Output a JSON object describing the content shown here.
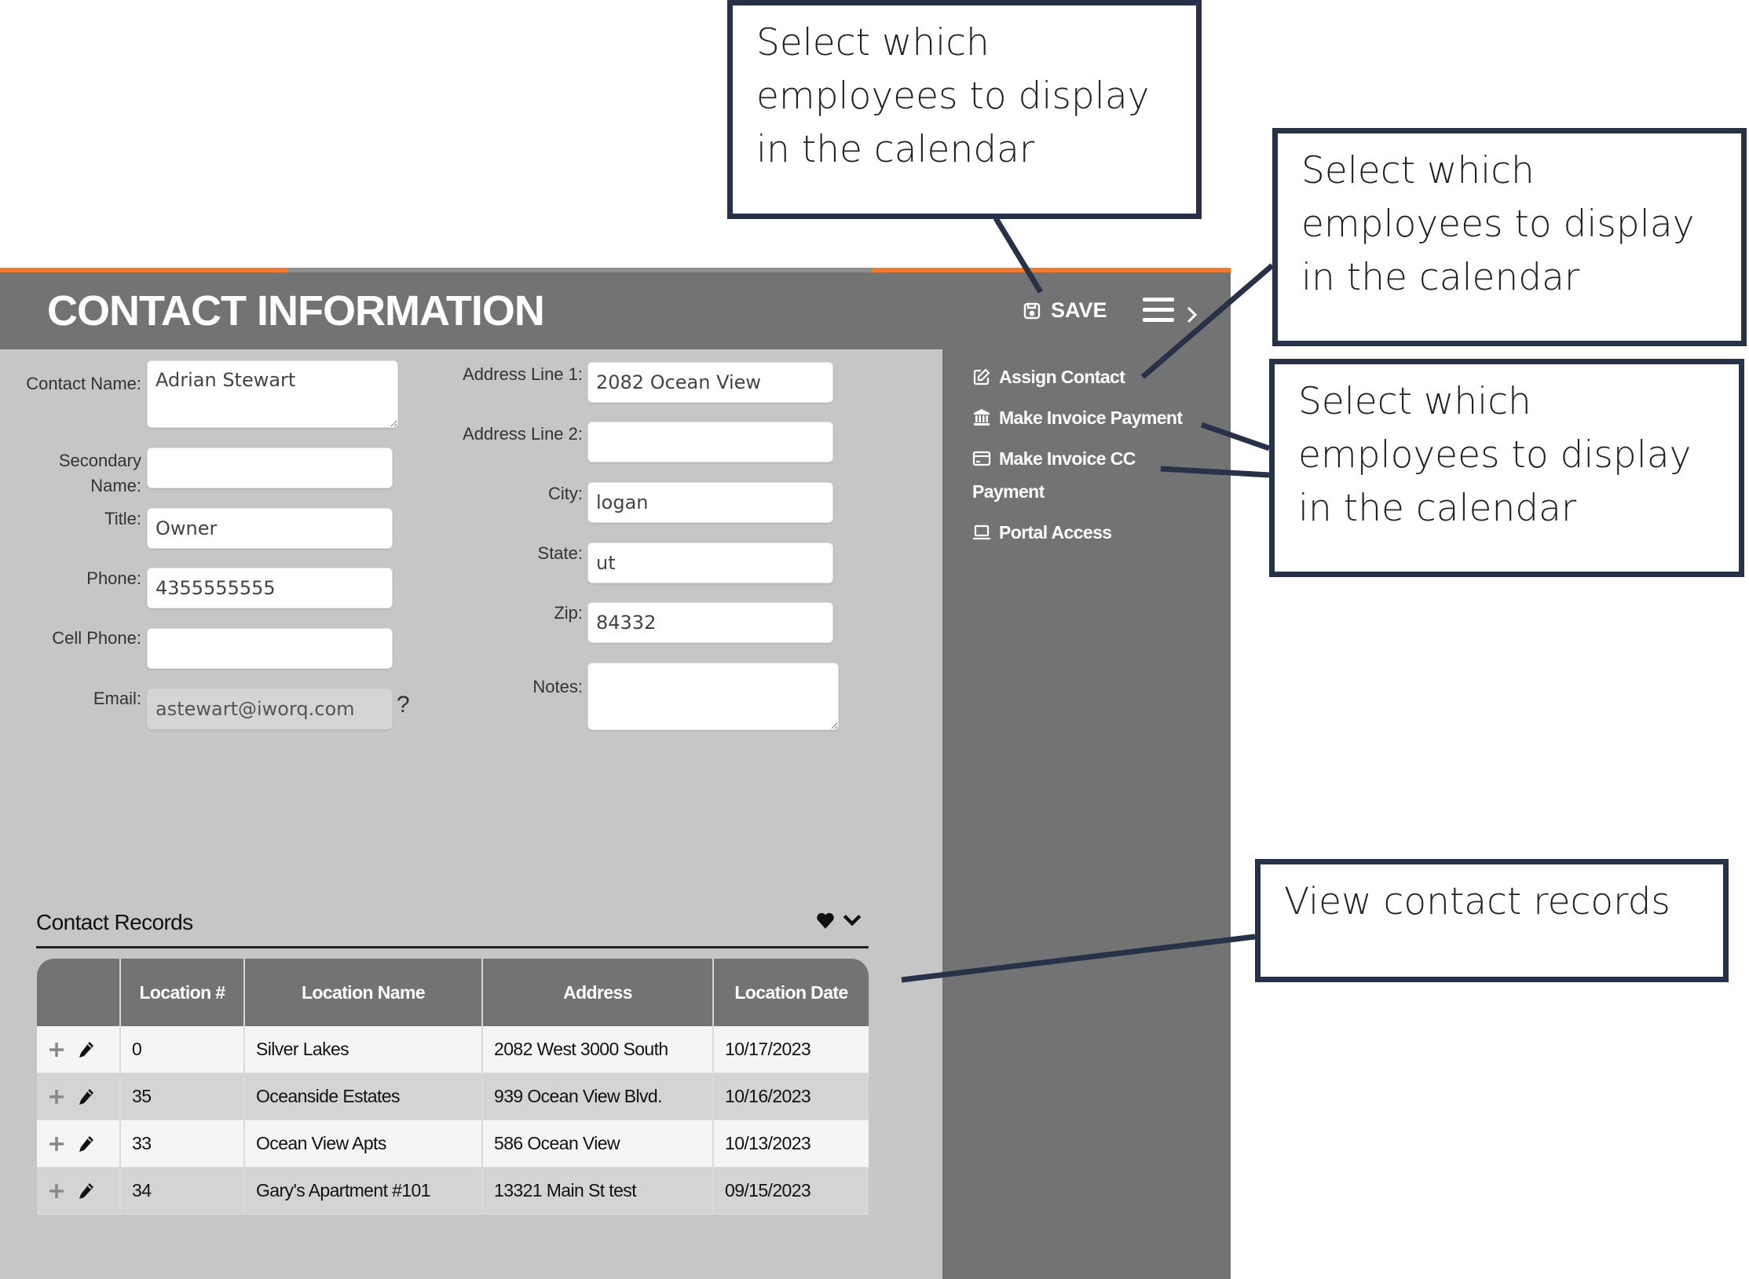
{
  "header": {
    "title": "CONTACT INFORMATION",
    "save_label": "SAVE",
    "save_icon": "floppy-disk-icon",
    "menu_icon": "hamburger-menu-icon",
    "expand_icon": "chevron-right-icon"
  },
  "sidebar": {
    "items": [
      {
        "label": "Assign Contact",
        "icon": "edit-icon"
      },
      {
        "label": "Make Invoice Payment",
        "icon": "bank-icon"
      },
      {
        "label": "Make Invoice CC Payment",
        "icon": "credit-card-icon"
      },
      {
        "label": "Portal Access",
        "icon": "laptop-icon"
      }
    ]
  },
  "form": {
    "left": {
      "contact_name": {
        "label": "Contact Name:",
        "value": "Adrian Stewart"
      },
      "secondary_name": {
        "label": "Secondary Name:",
        "value": ""
      },
      "title": {
        "label": "Title:",
        "value": "Owner"
      },
      "phone": {
        "label": "Phone:",
        "value": "4355555555"
      },
      "cell_phone": {
        "label": "Cell Phone:",
        "value": ""
      },
      "email": {
        "label": "Email:",
        "value": "astewart@iworq.com",
        "help": "?"
      }
    },
    "right": {
      "address1": {
        "label": "Address Line 1:",
        "value": "2082 Ocean View"
      },
      "address2": {
        "label": "Address Line 2:",
        "value": ""
      },
      "city": {
        "label": "City:",
        "value": "logan"
      },
      "state": {
        "label": "State:",
        "value": "ut"
      },
      "zip": {
        "label": "Zip:",
        "value": "84332"
      },
      "notes": {
        "label": "Notes:",
        "value": ""
      }
    }
  },
  "records": {
    "title": "Contact Records",
    "favorite_icon": "heart-icon",
    "collapse_icon": "chevron-down-icon",
    "columns": [
      "",
      "Location #",
      "Location Name",
      "Address",
      "Location Date"
    ],
    "rows": [
      {
        "location_num": "0",
        "location_name": "Silver Lakes",
        "address": "2082 West 3000 South",
        "date": "10/17/2023"
      },
      {
        "location_num": "35",
        "location_name": "Oceanside Estates",
        "address": "939 Ocean View Blvd.",
        "date": "10/16/2023"
      },
      {
        "location_num": "33",
        "location_name": "Ocean View Apts",
        "address": "586 Ocean View",
        "date": "10/13/2023"
      },
      {
        "location_num": "34",
        "location_name": "Gary's Apartment #101",
        "address": "13321 Main St test",
        "date": "09/15/2023"
      }
    ]
  },
  "callouts": [
    {
      "text": "Select which employees to display in the calendar",
      "target": "save"
    },
    {
      "text": "Select which employees to display in the calendar",
      "target": "assign-contact"
    },
    {
      "text": "Select which employees to display in the calendar",
      "target": "invoice-payments"
    },
    {
      "text": "View contact records",
      "target": "contact-records"
    }
  ],
  "colors": {
    "accent_orange": "#f07a2f",
    "header_gray": "#737373",
    "panel_gray": "#c6c6c6",
    "callout_border": "#273249"
  }
}
